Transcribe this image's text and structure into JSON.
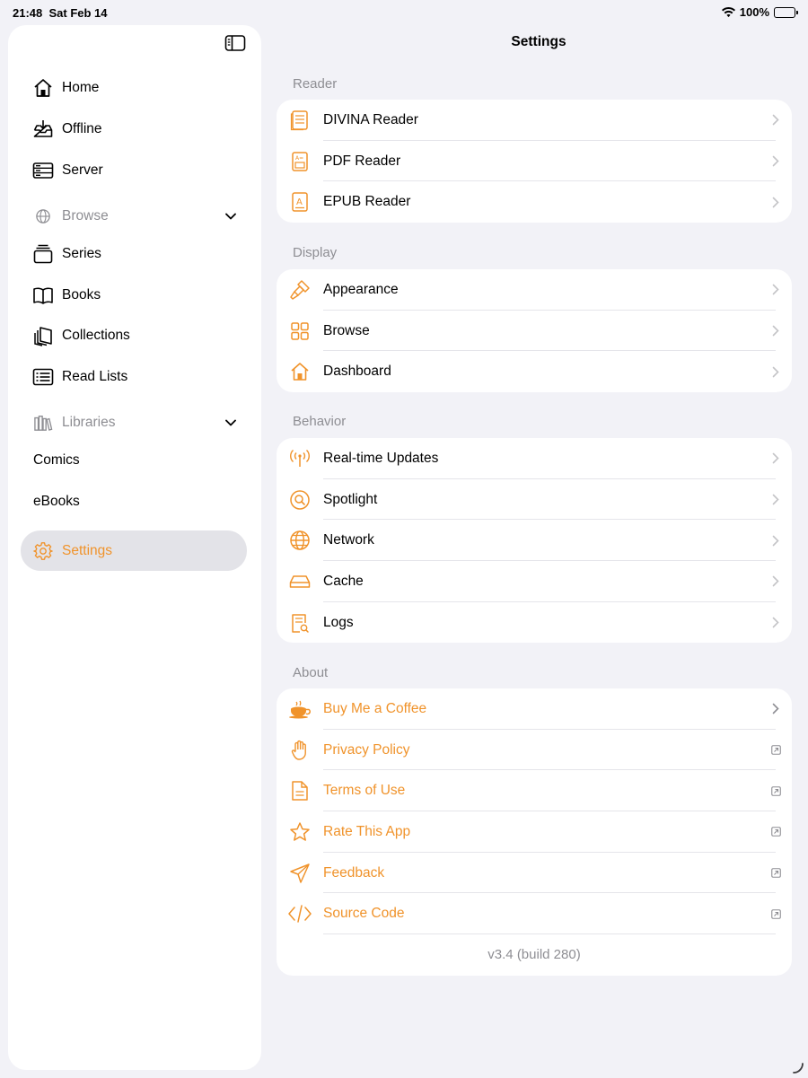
{
  "status": {
    "time": "21:48",
    "date": "Sat Feb 14",
    "battery": "100%"
  },
  "colors": {
    "accent": "#f0932b",
    "selected_bg": "#e3e3e8",
    "secondary_text": "#8e8e93"
  },
  "sidebar": {
    "items": [
      {
        "label": "Home",
        "icon": "house-icon"
      },
      {
        "label": "Offline",
        "icon": "tray-download-icon"
      },
      {
        "label": "Server",
        "icon": "server-icon"
      }
    ],
    "browse": {
      "label": "Browse",
      "items": [
        {
          "label": "Series",
          "icon": "stack-icon"
        },
        {
          "label": "Books",
          "icon": "book-icon"
        },
        {
          "label": "Collections",
          "icon": "collections-icon"
        },
        {
          "label": "Read Lists",
          "icon": "list-icon"
        }
      ]
    },
    "libraries": {
      "label": "Libraries",
      "items": [
        {
          "label": "Comics"
        },
        {
          "label": "eBooks"
        }
      ]
    },
    "settings": {
      "label": "Settings",
      "icon": "gear-icon"
    }
  },
  "main": {
    "title": "Settings",
    "sections": [
      {
        "header": "Reader",
        "rows": [
          {
            "label": "DIVINA Reader",
            "icon": "divina-icon"
          },
          {
            "label": "PDF Reader",
            "icon": "pdf-icon"
          },
          {
            "label": "EPUB Reader",
            "icon": "epub-icon"
          }
        ]
      },
      {
        "header": "Display",
        "rows": [
          {
            "label": "Appearance",
            "icon": "paintbrush-icon"
          },
          {
            "label": "Browse",
            "icon": "grid-icon"
          },
          {
            "label": "Dashboard",
            "icon": "house-icon"
          }
        ]
      },
      {
        "header": "Behavior",
        "rows": [
          {
            "label": "Real-time Updates",
            "icon": "antenna-icon"
          },
          {
            "label": "Spotlight",
            "icon": "spotlight-icon"
          },
          {
            "label": "Network",
            "icon": "globe-icon"
          },
          {
            "label": "Cache",
            "icon": "drive-icon"
          },
          {
            "label": "Logs",
            "icon": "log-icon"
          }
        ]
      },
      {
        "header": "About",
        "rows": [
          {
            "label": "Buy Me a Coffee",
            "icon": "coffee-icon"
          },
          {
            "label": "Privacy Policy",
            "icon": "hand-icon"
          },
          {
            "label": "Terms of Use",
            "icon": "document-icon"
          },
          {
            "label": "Rate This App",
            "icon": "star-icon"
          },
          {
            "label": "Feedback",
            "icon": "paperplane-icon"
          },
          {
            "label": "Source Code",
            "icon": "code-icon"
          }
        ]
      }
    ],
    "version": "v3.4 (build 280)"
  }
}
